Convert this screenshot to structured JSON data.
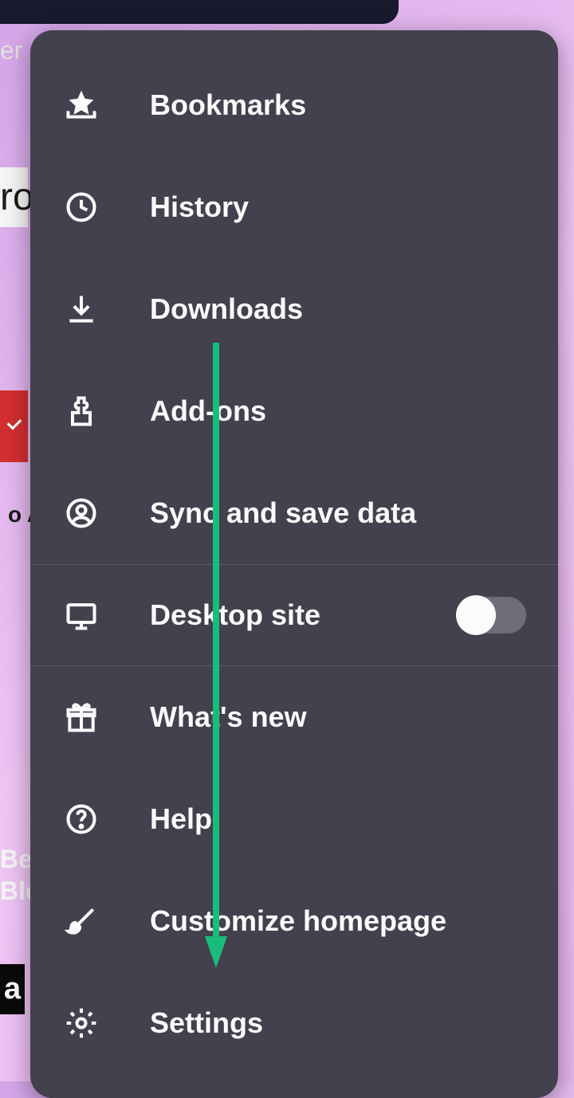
{
  "menu": {
    "items": [
      {
        "id": "bookmarks",
        "label": "Bookmarks",
        "icon": "star-tray"
      },
      {
        "id": "history",
        "label": "History",
        "icon": "clock"
      },
      {
        "id": "downloads",
        "label": "Downloads",
        "icon": "download"
      },
      {
        "id": "addons",
        "label": "Add-ons",
        "icon": "puzzle"
      },
      {
        "id": "sync",
        "label": "Sync and save data",
        "icon": "account"
      },
      {
        "id": "desktop-site",
        "label": "Desktop site",
        "icon": "desktop",
        "toggle": false
      },
      {
        "id": "whats-new",
        "label": "What's new",
        "icon": "gift"
      },
      {
        "id": "help",
        "label": "Help",
        "icon": "help"
      },
      {
        "id": "customize",
        "label": "Customize homepage",
        "icon": "brush"
      },
      {
        "id": "settings",
        "label": "Settings",
        "icon": "gear"
      }
    ]
  },
  "background": {
    "fragment_er": "er",
    "fragment_ro": "ro",
    "fragment_oa": "o A",
    "fragment_be": "Be",
    "fragment_bl": "Blo",
    "fragment_a": "a"
  },
  "annotation": {
    "type": "arrow",
    "color": "#1abc7b",
    "target": "settings"
  }
}
